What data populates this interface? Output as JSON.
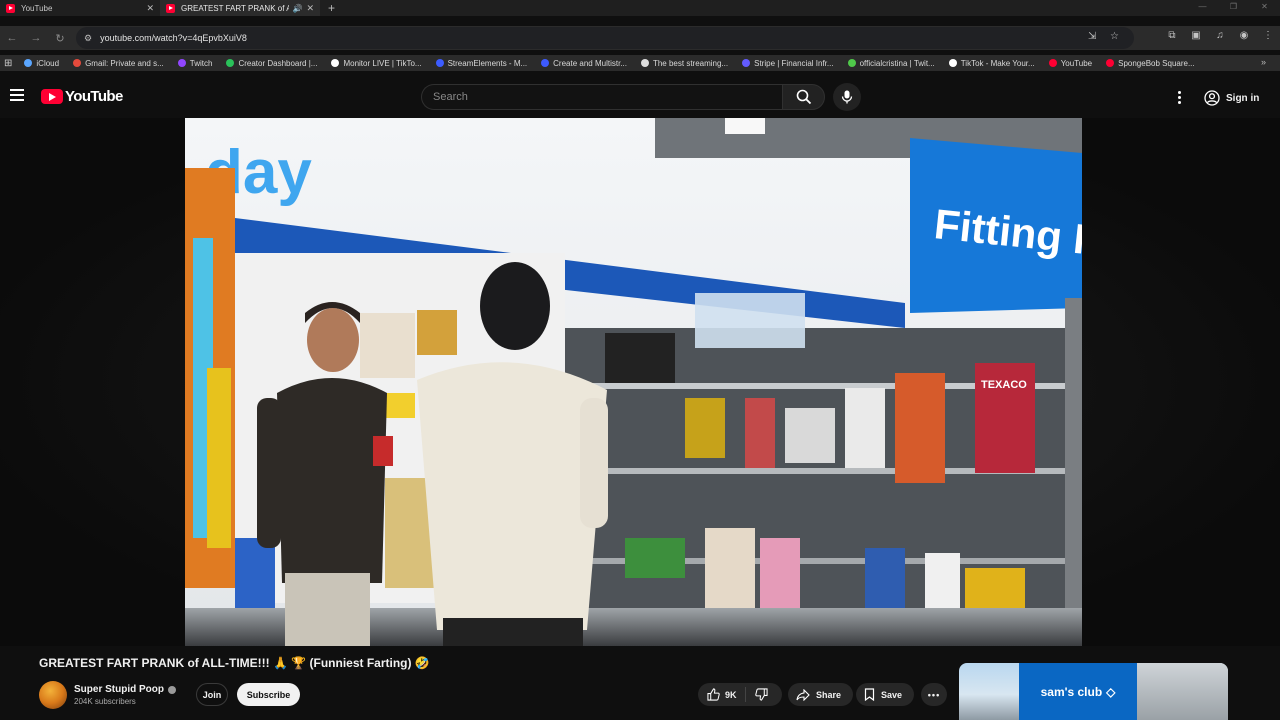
{
  "browser": {
    "tabs": [
      {
        "title": "YouTube",
        "active": false
      },
      {
        "title": "GREATEST FART PRANK of ALL-TIME!!!",
        "active": true
      }
    ],
    "url": "youtube.com/watch?v=4qEpvbXuiV8",
    "bookmarks": [
      {
        "label": "iCloud",
        "color": "#5aa6ff"
      },
      {
        "label": "Gmail: Private and s...",
        "color": "#e44a3c"
      },
      {
        "label": "Twitch",
        "color": "#9146ff"
      },
      {
        "label": "Creator Dashboard |...",
        "color": "#2ac25a"
      },
      {
        "label": "Monitor LIVE | TikTo...",
        "color": "#ffffff"
      },
      {
        "label": "StreamElements - M...",
        "color": "#3c5cff"
      },
      {
        "label": "Create and Multistr...",
        "color": "#3d5afe"
      },
      {
        "label": "The best streaming...",
        "color": "#dddddd"
      },
      {
        "label": "Stripe | Financial Infr...",
        "color": "#635bff"
      },
      {
        "label": "officialcristina | Twit...",
        "color": "#4fc94a"
      },
      {
        "label": "TikTok - Make Your...",
        "color": "#ffffff"
      },
      {
        "label": "YouTube",
        "color": "#ff0033"
      },
      {
        "label": "SpongeBob Square...",
        "color": "#ff0033"
      }
    ]
  },
  "youtube": {
    "logo_text": "YouTube",
    "search_placeholder": "Search",
    "signin_label": "Sign in"
  },
  "video": {
    "title": "GREATEST FART PRANK of ALL-TIME!!! 🙏 🏆 (Funniest Farting) 🤣",
    "scene_text": {
      "sign_left": "day",
      "sign_right": "Fitting Ro",
      "brand_tag": "TEXACO"
    }
  },
  "channel": {
    "name": "Super Stupid Poop",
    "subscribers": "204K subscribers",
    "join_label": "Join",
    "subscribe_label": "Subscribe"
  },
  "actions": {
    "likes": "9K",
    "share_label": "Share",
    "save_label": "Save"
  },
  "ad": {
    "brand": "sam's club"
  }
}
